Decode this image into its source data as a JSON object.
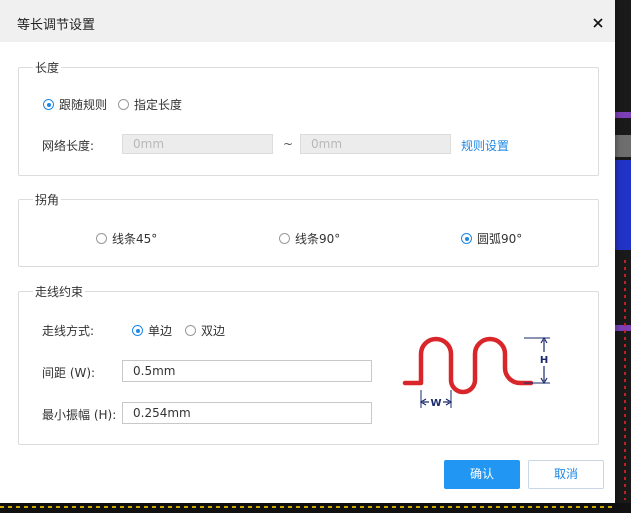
{
  "dialog": {
    "title": "等长调节设置",
    "close_icon": "close-icon"
  },
  "length": {
    "legend": "长度",
    "options": [
      "跟随规则",
      "指定长度"
    ],
    "selected": "跟随规则",
    "net_length_label": "网络长度:",
    "min_placeholder": "0mm",
    "separator": "~",
    "max_placeholder": "0mm",
    "rule_link": "规则设置"
  },
  "corner": {
    "legend": "拐角",
    "options": [
      "线条45°",
      "线条90°",
      "圆弧90°"
    ],
    "selected": "圆弧90°"
  },
  "routing": {
    "legend": "走线约束",
    "mode_label": "走线方式:",
    "mode_options": [
      "单边",
      "双边"
    ],
    "mode_selected": "单边",
    "spacing_label": "间距 (W):",
    "spacing_value": "0.5mm",
    "amplitude_label": "最小振幅 (H):",
    "amplitude_value": "0.254mm",
    "diagram": {
      "h_label": "H",
      "w_label": "W",
      "trace_color": "#d8262b",
      "dim_color": "#1a2a6c"
    }
  },
  "buttons": {
    "confirm": "确认",
    "cancel": "取消"
  },
  "colors": {
    "accent": "#1e88e5",
    "primary_button": "#2196f3"
  }
}
